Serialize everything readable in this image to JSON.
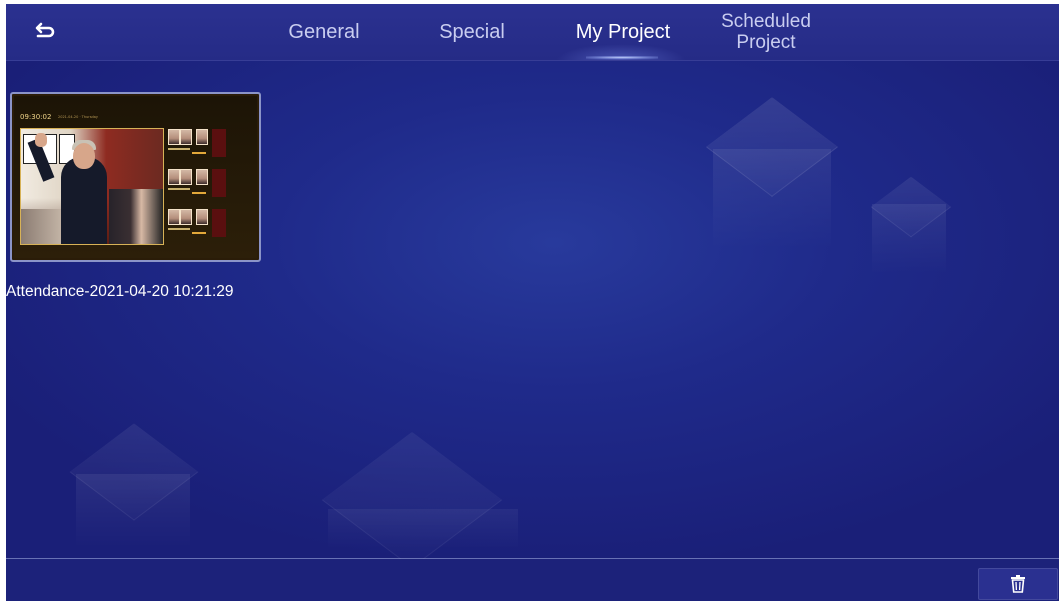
{
  "header": {
    "back_icon": "return-arrow-icon",
    "tabs": [
      {
        "label": "General",
        "active": false
      },
      {
        "label": "Special",
        "active": false
      },
      {
        "label": "My Project",
        "active": true
      },
      {
        "label_line1": "Scheduled",
        "label_line2": "Project",
        "active": false
      }
    ]
  },
  "projects": [
    {
      "thumbnail": {
        "time": "09:30:02",
        "date": "2021-04-20 · Thursday"
      },
      "label": "Attendance-2021-04-20 10:21:29"
    }
  ],
  "footer": {
    "delete_icon": "trash-icon"
  },
  "colors": {
    "background": "#1f2a8a",
    "topbar": "#2b3190",
    "tab_inactive": "#c9cdf0",
    "tab_active": "#ffffff",
    "card_border": "#8b94c8"
  }
}
